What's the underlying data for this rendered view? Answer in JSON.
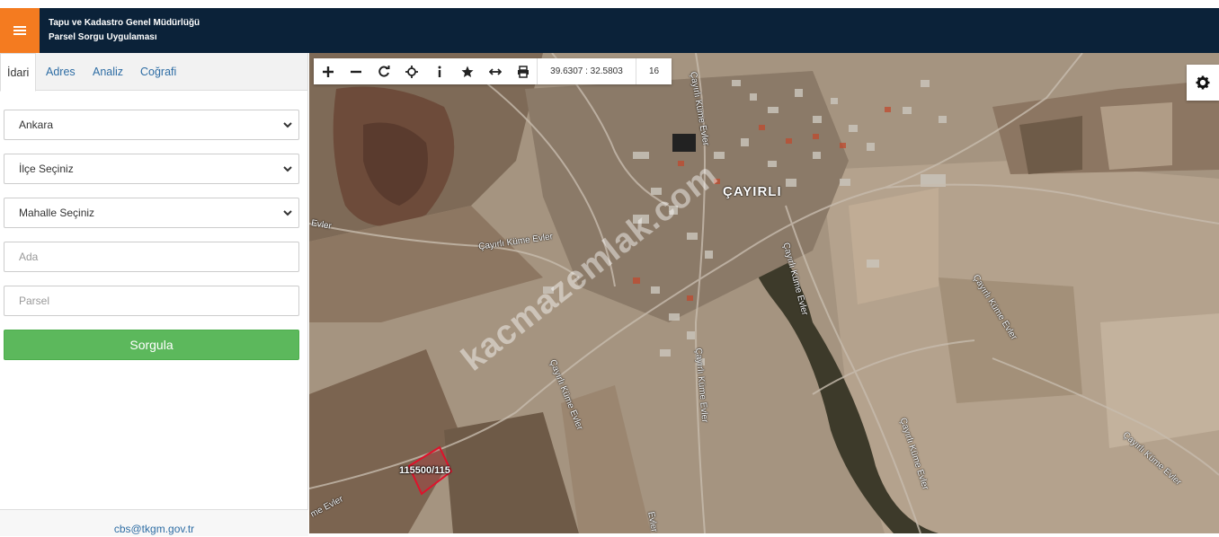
{
  "header": {
    "title_line1": "Tapu ve Kadastro Genel Müdürlüğü",
    "title_line2": "Parsel Sorgu Uygulaması",
    "menu_icon": "hamburger-icon",
    "menu_color": "#f47b20",
    "bar_color": "#0b2239"
  },
  "sidebar": {
    "tabs": [
      {
        "label": "İdari",
        "active": true
      },
      {
        "label": "Adres",
        "active": false
      },
      {
        "label": "Analiz",
        "active": false
      },
      {
        "label": "Coğrafi",
        "active": false
      }
    ],
    "province": {
      "selected": "Ankara"
    },
    "district": {
      "selected": "İlçe Seçiniz"
    },
    "neighborhood": {
      "selected": "Mahalle Seçiniz"
    },
    "block": {
      "placeholder": "Ada"
    },
    "parcel": {
      "placeholder": "Parsel"
    },
    "query_button": {
      "label": "Sorgula",
      "color": "#5cb85c"
    },
    "footer_email": "cbs@tkgm.gov.tr"
  },
  "map": {
    "toolbar": {
      "icons": [
        "zoom-in-icon",
        "zoom-out-icon",
        "refresh-icon",
        "locate-icon",
        "info-icon",
        "favorite-star-icon",
        "measure-icon",
        "print-icon"
      ],
      "coordinates": "39.6307 : 32.5803",
      "zoom_level": "16"
    },
    "settings_icon": "gear-icon",
    "labels": {
      "village": "ÇAYIRLI",
      "road_1": "Çayırlı Küme Evler",
      "road_2": "Çayırlı Küme Evler",
      "road_3": "Çayırlı Küme Evler",
      "road_4": "Çayırlı Küme Evler",
      "road_5": "Çayırlı Küme Evler",
      "road_6": "Çayırlı Küme Evler",
      "road_7": "Çayırlı Küme Evler",
      "edge_1": "Evler",
      "edge_2": "me Evler",
      "edge_3": "Evler"
    },
    "parcel_label": "115500/115",
    "parcel_color": "#e0112b",
    "watermark": "kacmazemlak.com"
  }
}
